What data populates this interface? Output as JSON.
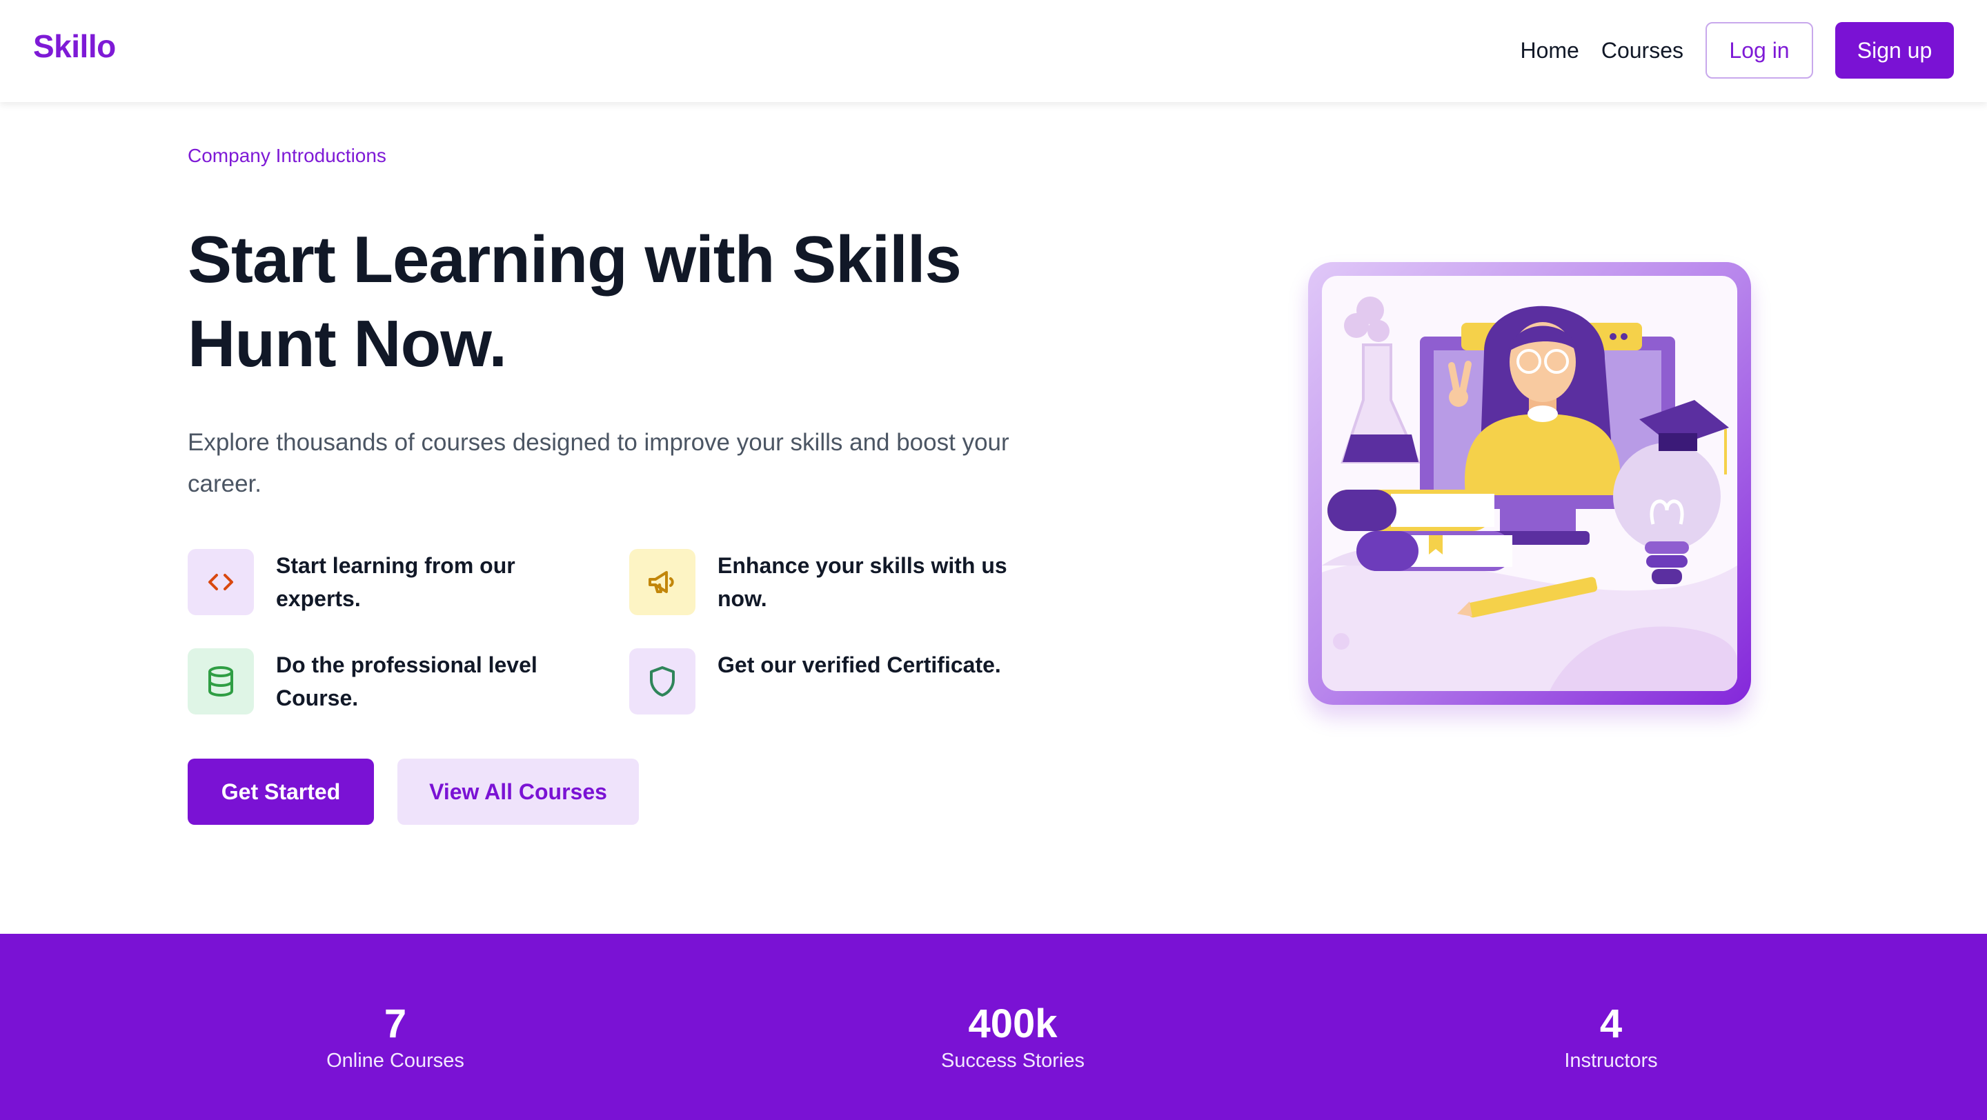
{
  "header": {
    "brand": "Skillo",
    "nav": {
      "home": "Home",
      "courses": "Courses"
    },
    "login_label": "Log in",
    "signup_label": "Sign up"
  },
  "hero": {
    "eyebrow": "Company Introductions",
    "title": "Start Learning with Skills Hunt Now.",
    "subtitle": "Explore thousands of courses designed to improve your skills and boost your career.",
    "features": [
      {
        "text": "Start learning from our experts.",
        "icon": "code-icon"
      },
      {
        "text": "Enhance your skills with us now.",
        "icon": "megaphone-icon"
      },
      {
        "text": "Do the professional level Course.",
        "icon": "database-icon"
      },
      {
        "text": "Get our verified Certificate.",
        "icon": "shield-icon"
      }
    ],
    "primary_cta": "Get Started",
    "secondary_cta": "View All Courses"
  },
  "stats": [
    {
      "value": "7",
      "label": "Online Courses"
    },
    {
      "value": "400k",
      "label": "Success Stories"
    },
    {
      "value": "4",
      "label": "Instructors"
    }
  ],
  "colors": {
    "brand": "#7a12d4",
    "brand_light": "#efe3fb",
    "heading": "#111827",
    "body_text": "#4b5563"
  }
}
